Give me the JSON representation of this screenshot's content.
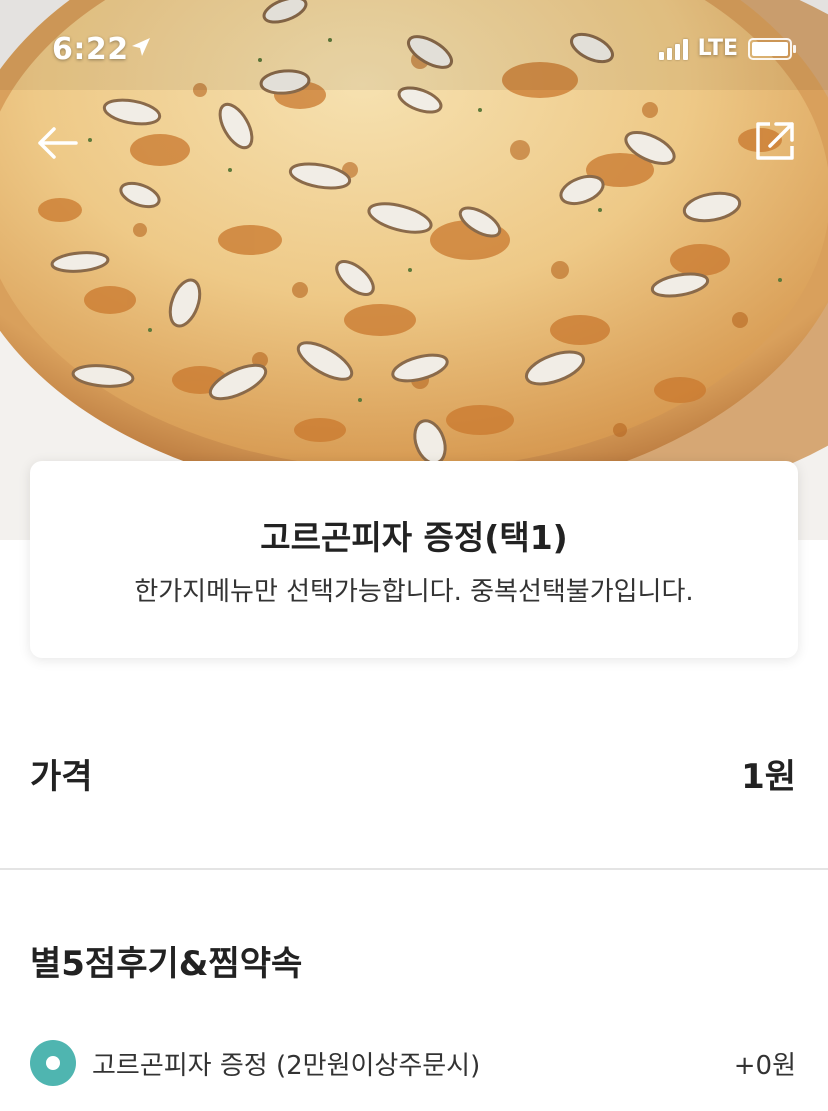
{
  "status_bar": {
    "time": "6:22",
    "network": "LTE"
  },
  "header": {
    "back_icon": "arrow-left-icon",
    "share_icon": "share-external-icon"
  },
  "hero_image": {
    "description_icon": "pizza-photo"
  },
  "menu_info": {
    "title": "고르곤피자 증정(택1)",
    "description": "한가지메뉴만 선택가능합니다. 중복선택불가입니다."
  },
  "price": {
    "label": "가격",
    "value": "1원"
  },
  "options_section": {
    "title": "별5점후기&찜약속",
    "items": [
      {
        "label": "고르곤피자 증정 (2만원이상주문시)",
        "price": "+0원",
        "selected": true
      }
    ]
  },
  "colors": {
    "accent": "#4fb5b0",
    "text": "#222222",
    "divider": "#e4e4e4"
  }
}
